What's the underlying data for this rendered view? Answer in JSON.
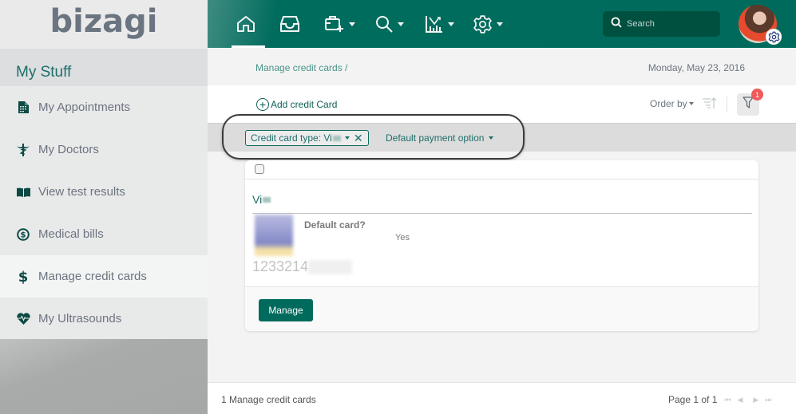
{
  "app": {
    "logo": "bizagi"
  },
  "sidebar": {
    "section_title": "My Stuff",
    "items": [
      {
        "label": "My Appointments",
        "icon": "document-icon",
        "active": false
      },
      {
        "label": "My Doctors",
        "icon": "caduceus-icon",
        "active": false
      },
      {
        "label": "View test results",
        "icon": "open-book-icon",
        "active": false
      },
      {
        "label": "Medical bills",
        "icon": "dollar-circle-icon",
        "active": false
      },
      {
        "label": "Manage credit cards",
        "icon": "dollar-icon",
        "active": true
      },
      {
        "label": "My Ultrasounds",
        "icon": "heartbeat-icon",
        "active": false
      }
    ]
  },
  "topbar": {
    "icons": [
      "home-icon",
      "inbox-icon",
      "new-case-icon",
      "search-icon",
      "analytics-icon",
      "settings-icon"
    ],
    "search_placeholder": "Search",
    "brand_color": "#006b5c"
  },
  "breadcrumb": {
    "text": "Manage credit cards /"
  },
  "date": "Monday, May 23, 2016",
  "toolbar": {
    "add_label": "Add credit Card",
    "order_by_label": "Order by",
    "filter_badge": "1"
  },
  "filters": {
    "chip_label": "Credit card type: Vi",
    "dropdown_label": "Default payment option"
  },
  "card": {
    "title": "Vi",
    "default_label": "Default card?",
    "default_value": "Yes",
    "number_visible": "1233214",
    "button_label": "Manage"
  },
  "footer": {
    "count_label": "1 Manage credit cards",
    "page_label": "Page 1 of 1",
    "pager_first": "⏮",
    "pager_prev": "◀",
    "pager_next": "▶",
    "pager_last": "⏭"
  }
}
